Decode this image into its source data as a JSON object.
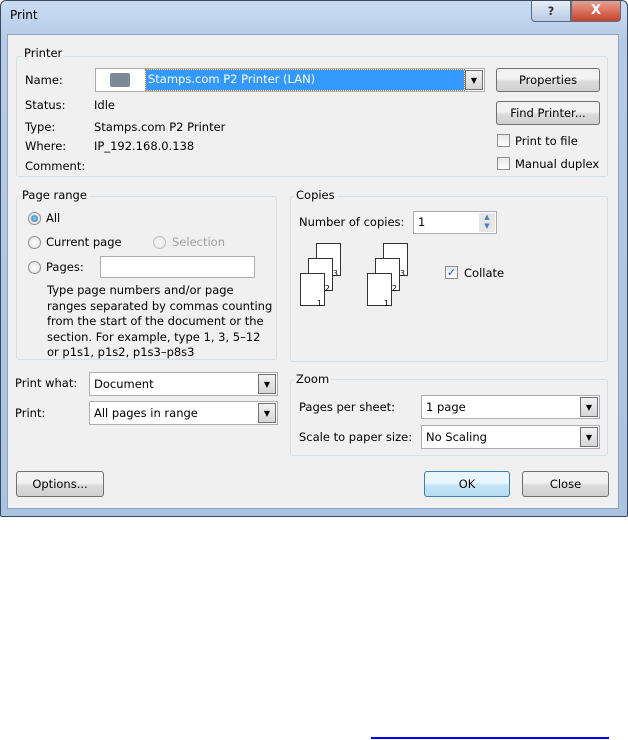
{
  "window": {
    "title": "Print",
    "help_label": "?",
    "close_label": "X"
  },
  "printer": {
    "group": "Printer",
    "name_label": "Name:",
    "name_value": "Stamps.com P2 Printer (LAN)",
    "status_label": "Status:",
    "status_value": "Idle",
    "type_label": "Type:",
    "type_value": "Stamps.com P2 Printer",
    "where_label": "Where:",
    "where_value": "IP_192.168.0.138",
    "comment_label": "Comment:",
    "properties": "Properties",
    "find_printer": "Find Printer...",
    "print_to_file": "Print to file",
    "manual_duplex": "Manual duplex",
    "print_to_file_checked": false,
    "manual_duplex_checked": false
  },
  "page_range": {
    "group": "Page range",
    "all": "All",
    "current_page": "Current page",
    "selection": "Selection",
    "pages": "Pages:",
    "pages_value": "",
    "selected": "All",
    "help": [
      "Type page numbers and/or page",
      "ranges separated by commas counting",
      "from the start of the document or the",
      "section. For example, type 1, 3, 5–12",
      "or p1s1, p1s2, p1s3–p8s3"
    ]
  },
  "copies": {
    "group": "Copies",
    "number_label": "Number of copies:",
    "number_value": "1",
    "collate": "Collate",
    "collate_checked": true,
    "page_labels": [
      "1",
      "2",
      "3"
    ]
  },
  "print_what": {
    "label": "Print what:",
    "value": "Document"
  },
  "print": {
    "label": "Print:",
    "value": "All pages in range"
  },
  "zoom": {
    "group": "Zoom",
    "pages_per_sheet_label": "Pages per sheet:",
    "pages_per_sheet_value": "1 page",
    "scale_label": "Scale to paper size:",
    "scale_value": "No Scaling"
  },
  "buttons": {
    "options": "Options...",
    "ok": "OK",
    "close": "Close"
  },
  "colors": {
    "selection": "#3399ff",
    "link_line": "#0000ff"
  }
}
